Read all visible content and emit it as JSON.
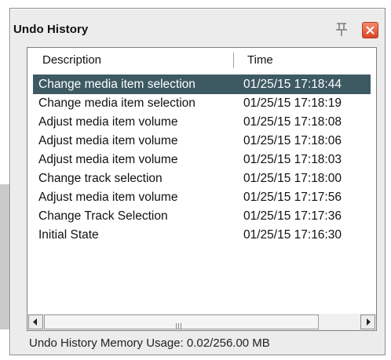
{
  "window": {
    "title": "Undo History"
  },
  "columns": {
    "description": "Description",
    "time": "Time"
  },
  "rows": [
    {
      "description": "Change media item selection",
      "time": "01/25/15 17:18:44",
      "selected": true
    },
    {
      "description": "Change media item selection",
      "time": "01/25/15 17:18:19"
    },
    {
      "description": "Adjust media item volume",
      "time": "01/25/15 17:18:08"
    },
    {
      "description": "Adjust media item volume",
      "time": "01/25/15 17:18:06"
    },
    {
      "description": "Adjust media item volume",
      "time": "01/25/15 17:18:03"
    },
    {
      "description": "Change track selection",
      "time": "01/25/15 17:18:00"
    },
    {
      "description": "Adjust media item volume",
      "time": "01/25/15 17:17:56"
    },
    {
      "description": "Change Track Selection",
      "time": "01/25/15 17:17:36"
    },
    {
      "description": "Initial State",
      "time": "01/25/15 17:16:30"
    }
  ],
  "status": {
    "memory_usage": "Undo History Memory Usage: 0.02/256.00 MB"
  },
  "icons": {
    "pin": "pin-icon",
    "close": "close-icon",
    "scroll_left": "scroll-left-icon",
    "scroll_right": "scroll-right-icon"
  },
  "colors": {
    "selection": "#3d5a63",
    "close_button": "#e2573a"
  }
}
